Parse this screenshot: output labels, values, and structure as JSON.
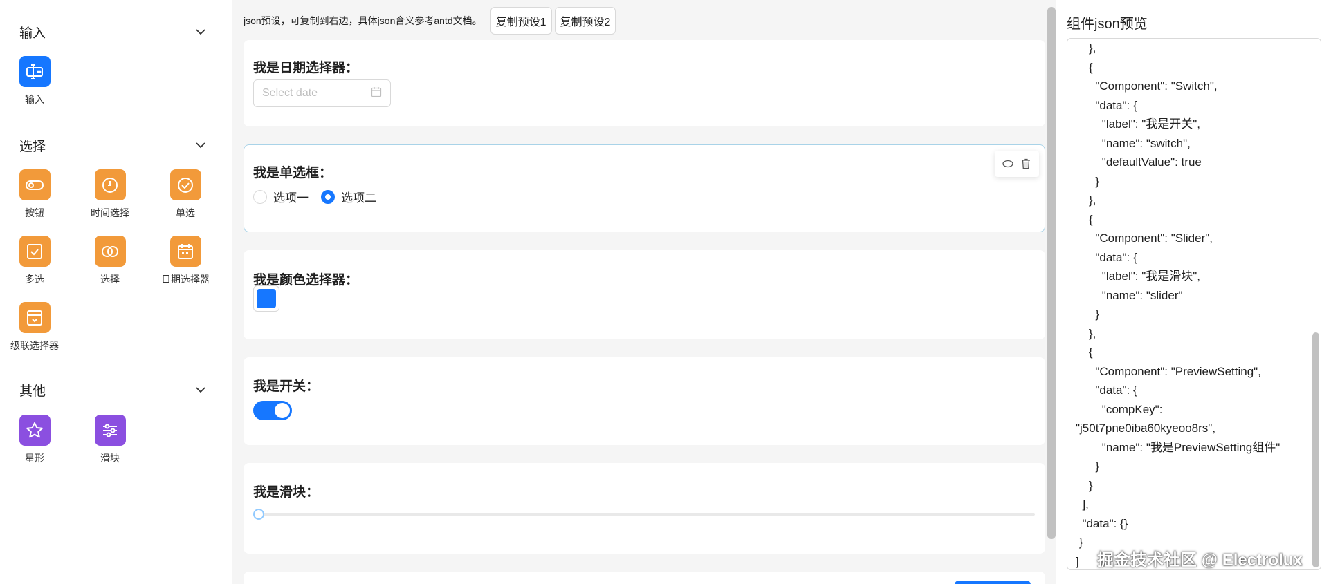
{
  "sidebar": {
    "groups": [
      {
        "title": "输入",
        "items": [
          {
            "label": "输入",
            "icon": "input-icon",
            "color": "#1677ff"
          }
        ]
      },
      {
        "title": "选择",
        "items": [
          {
            "label": "按钮",
            "icon": "toggle-icon",
            "color": "#f29a3a"
          },
          {
            "label": "时间选择",
            "icon": "clock-icon",
            "color": "#f29a3a"
          },
          {
            "label": "单选",
            "icon": "check-circle-icon",
            "color": "#f29a3a"
          },
          {
            "label": "多选",
            "icon": "check-square-icon",
            "color": "#f29a3a"
          },
          {
            "label": "选择",
            "icon": "link-rings-icon",
            "color": "#f29a3a"
          },
          {
            "label": "日期选择器",
            "icon": "calendar-icon",
            "color": "#f29a3a"
          },
          {
            "label": "级联选择器",
            "icon": "cascader-icon",
            "color": "#f29a3a"
          }
        ]
      },
      {
        "title": "其他",
        "items": [
          {
            "label": "星形",
            "icon": "star-icon",
            "color": "#8b4fe0"
          },
          {
            "label": "滑块",
            "icon": "sliders-icon",
            "color": "#8b4fe0"
          }
        ]
      }
    ]
  },
  "toolbar": {
    "hint": "json预设，可复制到右边，具体json含义参考antd文档。",
    "preset1_label": "复制预设1",
    "preset2_label": "复制预设2"
  },
  "form": {
    "date": {
      "label": "我是日期选择器：",
      "placeholder": "Select date"
    },
    "radio": {
      "label": "我是单选框：",
      "options": [
        "选项一",
        "选项二"
      ],
      "selected": "选项二"
    },
    "color": {
      "label": "我是颜色选择器：",
      "value": "#1677ff"
    },
    "switch": {
      "label": "我是开关：",
      "checked": true
    },
    "slider": {
      "label": "我是滑块：",
      "value": 0
    }
  },
  "preview": {
    "title": "组件json预览",
    "json_lines": [
      "    },",
      "    {",
      "      \"Component\": \"Switch\",",
      "      \"data\": {",
      "        \"label\": \"我是开关\",",
      "        \"name\": \"switch\",",
      "        \"defaultValue\": true",
      "      }",
      "    },",
      "    {",
      "      \"Component\": \"Slider\",",
      "      \"data\": {",
      "        \"label\": \"我是滑块\",",
      "        \"name\": \"slider\"",
      "      }",
      "    },",
      "    {",
      "      \"Component\": \"PreviewSetting\",",
      "      \"data\": {",
      "        \"compKey\":",
      "\"j50t7pne0iba60kyeoo8rs\",",
      "        \"name\": \"我是PreviewSetting组件\"",
      "      }",
      "    }",
      "  ],",
      "  \"data\": {}",
      " }",
      "]"
    ]
  },
  "watermark": "掘金技术社区 @ Electrolux"
}
